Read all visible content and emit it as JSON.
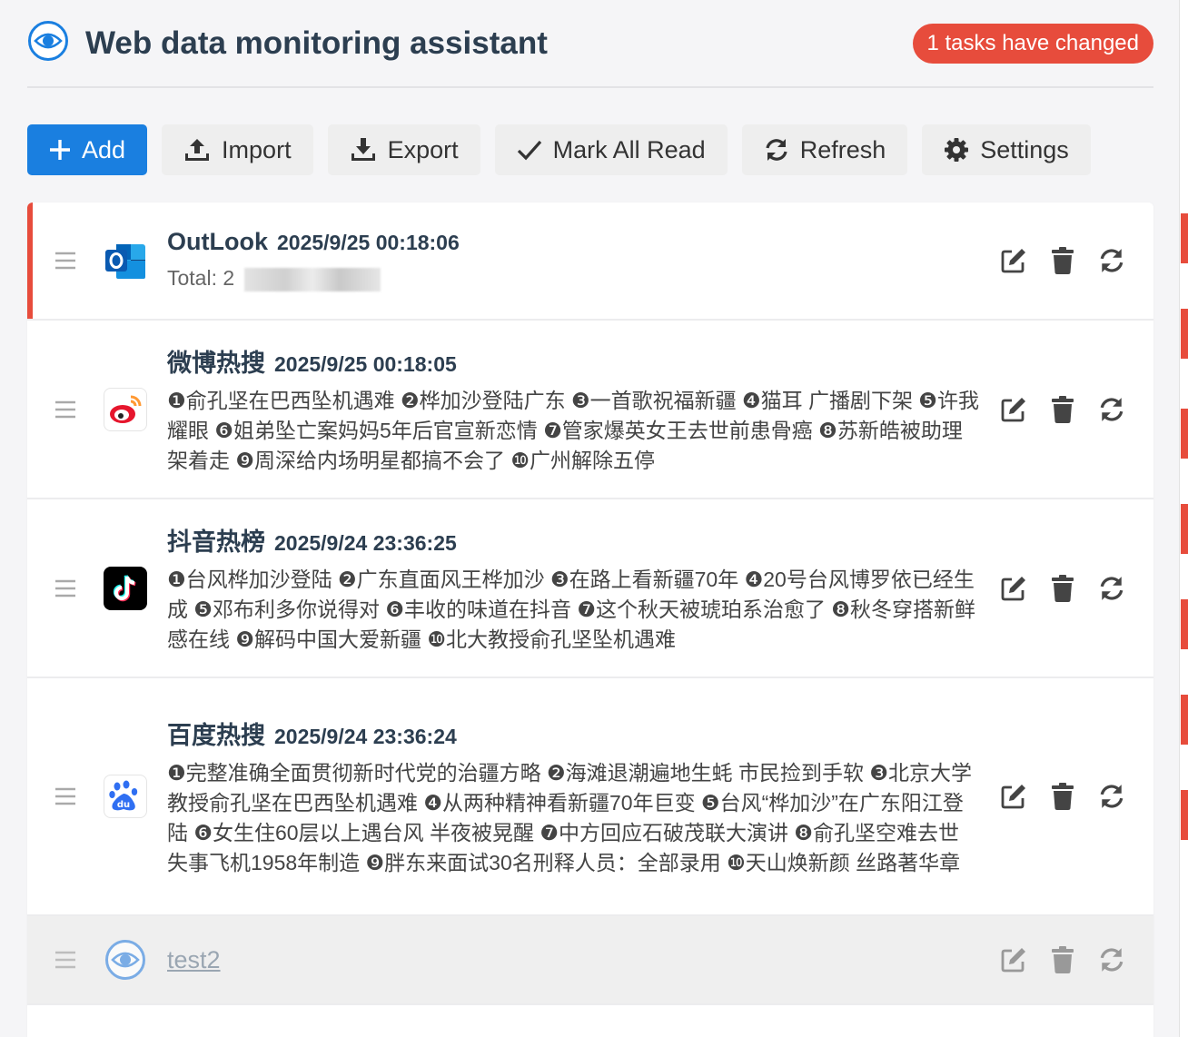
{
  "header": {
    "title": "Web data monitoring assistant",
    "badge": "1 tasks have changed"
  },
  "toolbar": {
    "add": "Add",
    "import": "Import",
    "export": "Export",
    "mark_all_read": "Mark All Read",
    "refresh": "Refresh",
    "settings": "Settings"
  },
  "colors": {
    "primary": "#1a7fe0",
    "alert": "#e74c3c",
    "title": "#2c3e50"
  },
  "tasks": [
    {
      "icon": "outlook-icon",
      "title": "OutLook",
      "time": "2025/9/25 00:18:06",
      "summary": "Total: 2",
      "changed": true
    },
    {
      "icon": "weibo-icon",
      "title": "微博热搜",
      "time": "2025/9/25 00:18:05",
      "summary": "❶俞孔坚在巴西坠机遇难 ❷桦加沙登陆广东 ❸一首歌祝福新疆 ❹猫耳 广播剧下架 ❺许我耀眼 ❻姐弟坠亡案妈妈5年后官宣新恋情 ❼管家爆英女王去世前患骨癌 ❽苏新皓被助理架着走 ❾周深给内场明星都搞不会了 ❿广州解除五停"
    },
    {
      "icon": "douyin-icon",
      "title": "抖音热榜",
      "time": "2025/9/24 23:36:25",
      "summary": "❶台风桦加沙登陆 ❷广东直面风王桦加沙 ❸在路上看新疆70年 ❹20号台风博罗依已经生成 ❺邓布利多你说得对 ❻丰收的味道在抖音 ❼这个秋天被琥珀系治愈了 ❽秋冬穿搭新鲜感在线 ❾解码中国大爱新疆 ❿北大教授俞孔坚坠机遇难"
    },
    {
      "icon": "baidu-icon",
      "title": "百度热搜",
      "time": "2025/9/24 23:36:24",
      "summary": "❶完整准确全面贯彻新时代党的治疆方略 ❷海滩退潮遍地生蚝 市民捡到手软 ❸北京大学教授俞孔坚在巴西坠机遇难 ❹从两种精神看新疆70年巨变 ❺台风“桦加沙”在广东阳江登陆 ❻女生住60层以上遇台风 半夜被晃醒 ❼中方回应石破茂联大演讲 ❽俞孔坚空难去世 失事飞机1958年制造 ❾胖东来面试30名刑释人员：全部录用 ❿天山焕新颜 丝路著华章"
    },
    {
      "icon": "eye-icon",
      "title": "test2",
      "time": "",
      "summary": "",
      "disabled": true
    }
  ]
}
